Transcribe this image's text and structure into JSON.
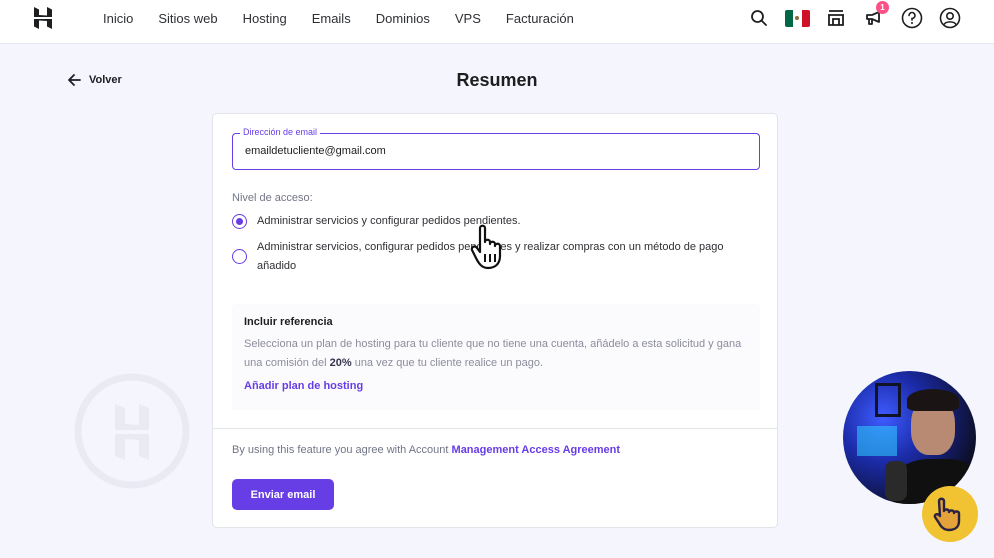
{
  "topbar": {
    "logo": "hostinger-logo",
    "nav": [
      {
        "label": "Inicio"
      },
      {
        "label": "Sitios web"
      },
      {
        "label": "Hosting"
      },
      {
        "label": "Emails"
      },
      {
        "label": "Dominios"
      },
      {
        "label": "VPS"
      },
      {
        "label": "Facturación"
      }
    ],
    "icons": {
      "search": "search-icon",
      "flag": "mexico-flag-icon",
      "store": "store-icon",
      "notifications": "megaphone-icon",
      "help": "help-icon",
      "account": "account-icon"
    },
    "notification_count": "1",
    "flag_colors": [
      "#006847",
      "#ffffff",
      "#ce1126"
    ]
  },
  "page": {
    "back_label": "Volver",
    "title": "Resumen"
  },
  "form": {
    "email_label": "Dirección de email",
    "email_value": "emaildetucliente@gmail.com",
    "access_label": "Nivel de acceso:",
    "access_options": [
      {
        "label": "Administrar servicios y configurar pedidos pendientes.",
        "selected": true
      },
      {
        "label": "Administrar servicios, configurar pedidos pendientes y realizar compras con un método de pago añadido",
        "selected": false
      }
    ],
    "referral": {
      "title": "Incluir referencia",
      "desc_before": "Selecciona un plan de hosting para tu cliente que no tiene una cuenta, añádelo a esta solicitud y gana una comisión del ",
      "desc_bold": "20%",
      "desc_after": " una vez que tu cliente realice un pago.",
      "link": "Añadir plan de hosting"
    },
    "agreement_prefix": "By using this feature you agree with Account ",
    "agreement_link": "Management Access Agreement",
    "submit_label": "Enviar email"
  },
  "colors": {
    "accent": "#673de6",
    "badge": "#fc5185",
    "background": "#f4f5fd"
  }
}
